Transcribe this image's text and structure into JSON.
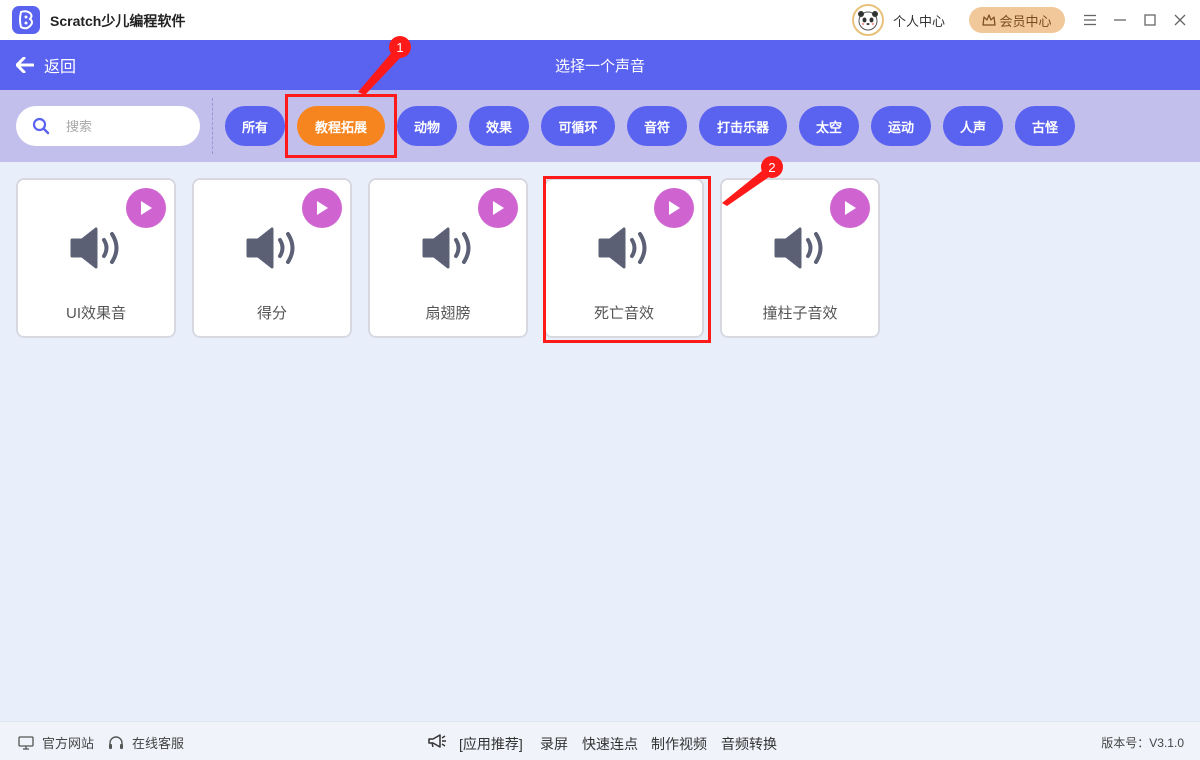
{
  "titlebar": {
    "app_title": "Scratch少儿编程软件",
    "user_center": "个人中心",
    "vip_center": "会员中心"
  },
  "header": {
    "back_label": "返回",
    "title": "选择一个声音"
  },
  "search": {
    "placeholder": "搜索"
  },
  "categories": [
    {
      "label": "所有"
    },
    {
      "label": "教程拓展",
      "active": true
    },
    {
      "label": "动物"
    },
    {
      "label": "效果"
    },
    {
      "label": "可循环"
    },
    {
      "label": "音符"
    },
    {
      "label": "打击乐器"
    },
    {
      "label": "太空"
    },
    {
      "label": "运动"
    },
    {
      "label": "人声"
    },
    {
      "label": "古怪"
    }
  ],
  "sounds": [
    {
      "name": "UI效果音"
    },
    {
      "name": "得分"
    },
    {
      "name": "扇翅膀"
    },
    {
      "name": "死亡音效"
    },
    {
      "name": "撞柱子音效"
    }
  ],
  "annotations": [
    "1",
    "2"
  ],
  "footer": {
    "official_site": "官方网站",
    "online_service": "在线客服",
    "recommend": "[应用推荐]",
    "links": [
      "录屏",
      "快速连点",
      "制作视频",
      "音频转换"
    ],
    "version": "版本号：V3.1.0"
  },
  "colors": {
    "primary": "#5a62f0",
    "active_category": "#f7851f",
    "play_button": "#cf63cf",
    "annotation": "#ff1a1a",
    "filter_bar": "#c3bfec"
  }
}
